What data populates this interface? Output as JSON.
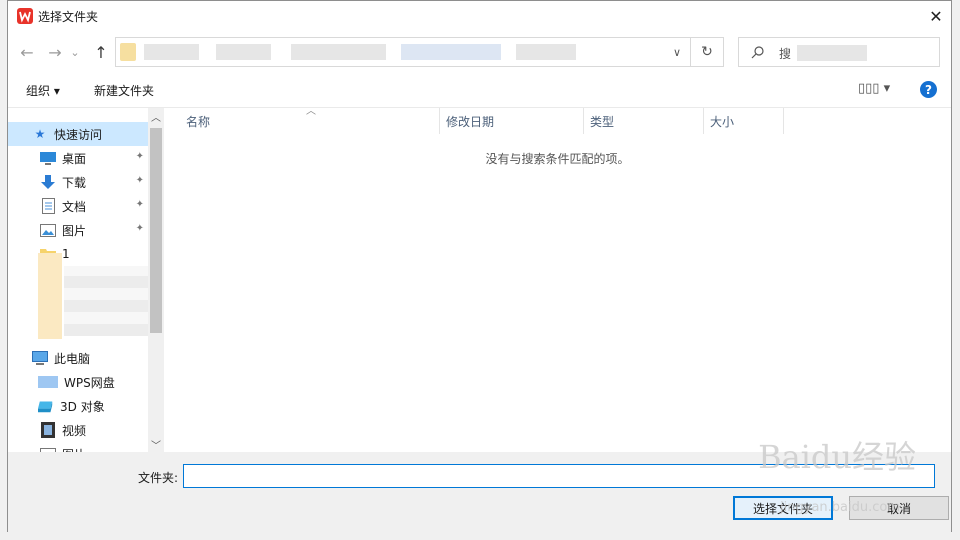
{
  "window": {
    "title": "选择文件夹",
    "close": "✕",
    "accent": "#0078d7",
    "app_icon_color": "#e8332a"
  },
  "nav": {
    "back": "←",
    "forward": "→",
    "recent": "⌄",
    "up": "↑",
    "dropdown": "∨",
    "refresh": "↻"
  },
  "search": {
    "placeholder": "搜"
  },
  "toolbar": {
    "organize": "组织 ▾",
    "new_folder": "新建文件夹",
    "view": "▯▯▯ ▾",
    "help": "?"
  },
  "sidebar": {
    "quick_access": "快速访问",
    "items": [
      {
        "label": "桌面",
        "icon": "desktop-icon",
        "pinned": true
      },
      {
        "label": "下载",
        "icon": "download-icon",
        "pinned": true
      },
      {
        "label": "文档",
        "icon": "document-icon",
        "pinned": true
      },
      {
        "label": "图片",
        "icon": "pictures-icon",
        "pinned": true
      },
      {
        "label": "1",
        "icon": "folder-icon",
        "pinned": false
      }
    ],
    "this_pc": "此电脑",
    "pc_items": [
      {
        "label": "WPS网盘",
        "icon": "cloud-drive-icon"
      },
      {
        "label": "3D 对象",
        "icon": "3d-objects-icon"
      },
      {
        "label": "视频",
        "icon": "video-icon"
      },
      {
        "label": "图片",
        "icon": "pictures-icon"
      }
    ],
    "pin_glyph": "📌"
  },
  "columns": [
    "名称",
    "修改日期",
    "类型",
    "大小"
  ],
  "empty_message": "没有与搜索条件匹配的项。",
  "footer": {
    "folder_label": "文件夹:",
    "folder_value": "",
    "select_button": "选择文件夹",
    "cancel_button": "取消"
  },
  "watermark": {
    "main": "Baidu经验",
    "sub": "jingyan.baidu.com"
  }
}
